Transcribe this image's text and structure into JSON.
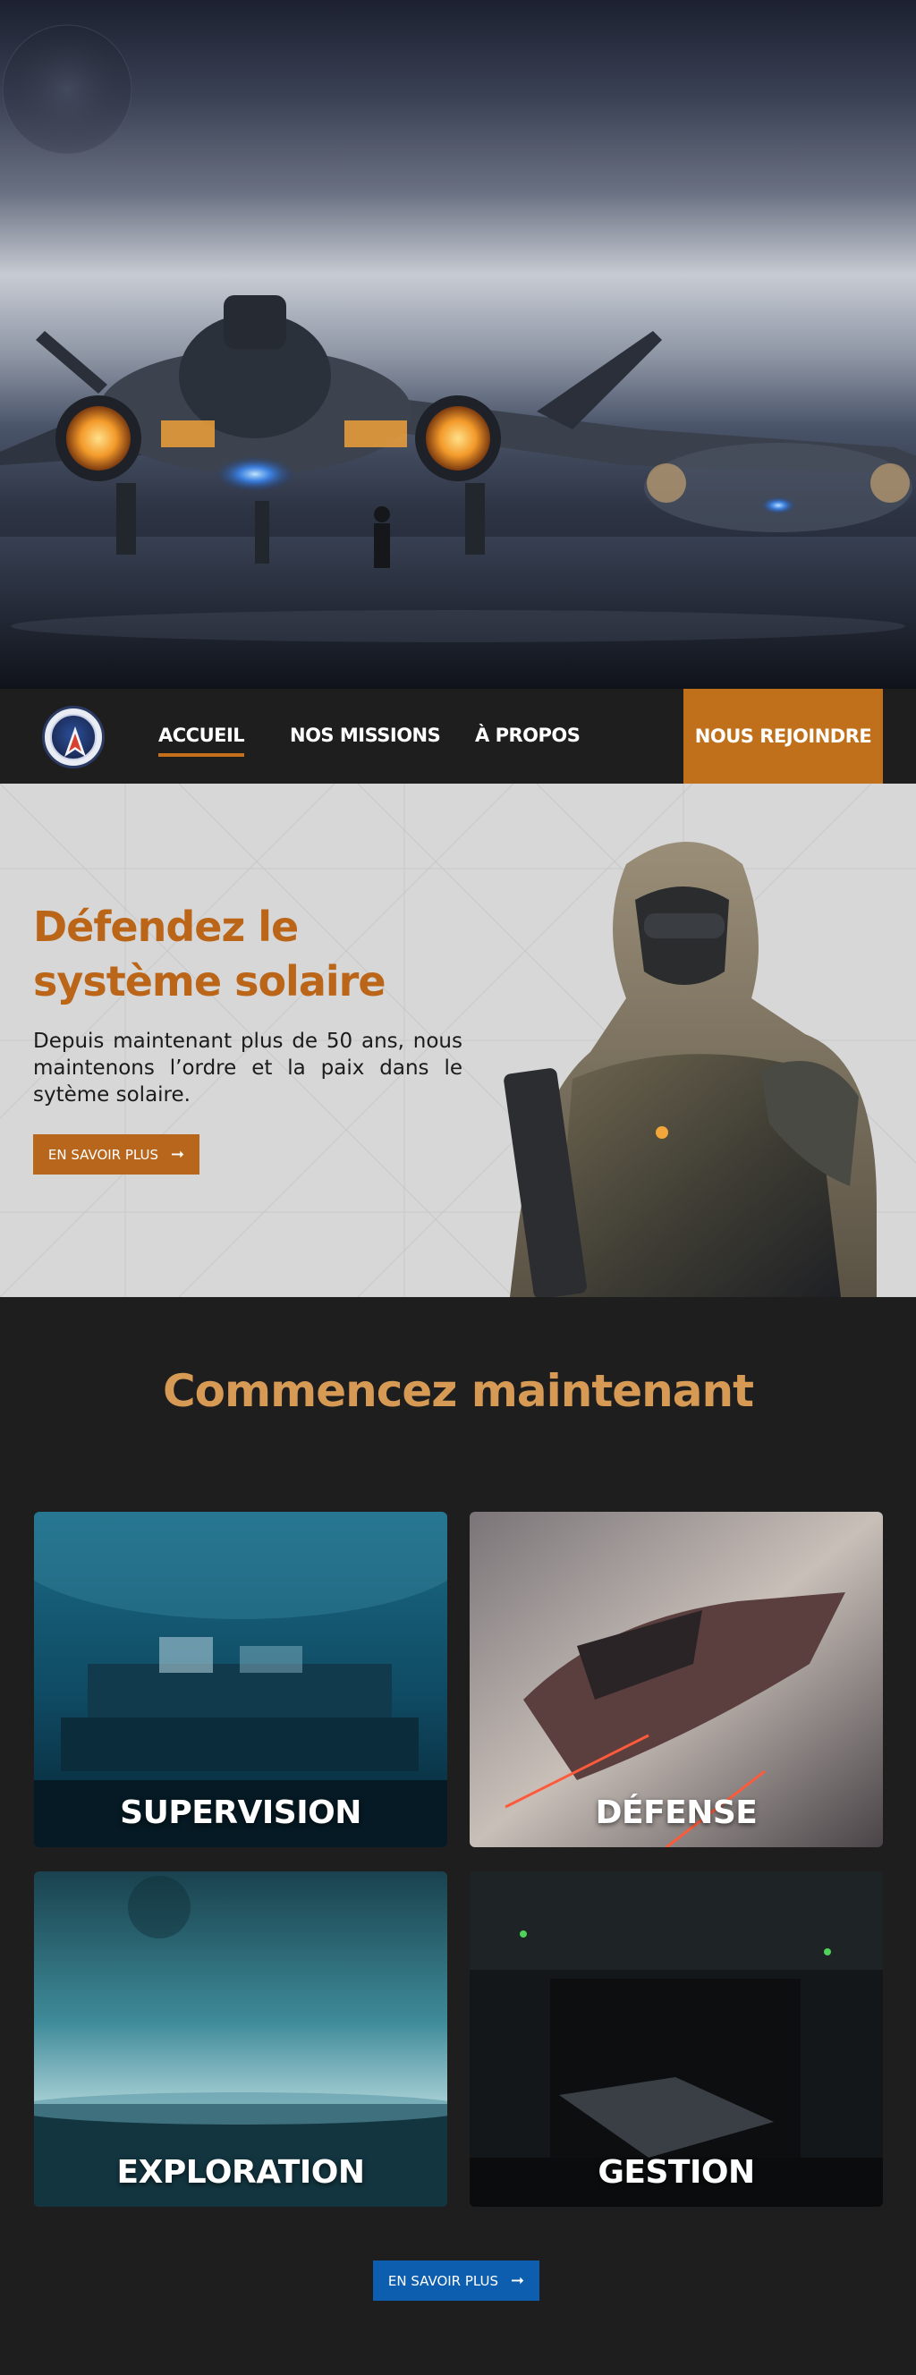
{
  "nav": {
    "logo_alt": "logo",
    "links": [
      {
        "label": "ACCUEIL"
      },
      {
        "label": "NOS MISSIONS"
      },
      {
        "label": "À PROPOS"
      }
    ],
    "join_label": "NOUS REJOINDRE"
  },
  "defend": {
    "title": "Défendez le système solaire",
    "text": "Depuis maintenant plus de 50 ans, nous maintenons l’ordre et la paix dans le sytème solaire.",
    "button_label": "EN SAVOIR PLUS",
    "button_icon": "arrow-right-icon"
  },
  "start": {
    "title": "Commencez maintenant",
    "cards": [
      {
        "label": "SUPERVISION"
      },
      {
        "label": "DÉFENSE"
      },
      {
        "label": "EXPLORATION"
      },
      {
        "label": "GESTION"
      }
    ],
    "button_label": "EN SAVOIR PLUS",
    "button_icon": "arrow-right-icon"
  },
  "colors": {
    "accent_orange": "#c0701a",
    "title_gold": "#d69a55",
    "button_blue": "#0e5eb0",
    "dark_bg": "#1f1e1f"
  }
}
